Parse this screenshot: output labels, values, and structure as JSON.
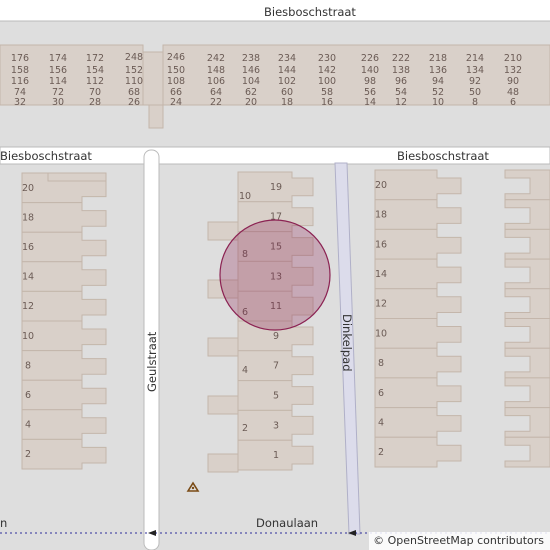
{
  "roads": {
    "top": "Biesboschstraat",
    "left_segment": "Biesboschstraat",
    "right_segment": "Biesboschstraat",
    "vertical_left": "Geulstraat",
    "vertical_right": "Dinkelpad",
    "bottom": "Donaulaan",
    "bottom_left_fragment": "n"
  },
  "top_block_numbers": [
    [
      "176",
      "158",
      "116",
      "74",
      "32"
    ],
    [
      "174",
      "156",
      "114",
      "72",
      "30"
    ],
    [
      "172",
      "154",
      "112",
      "70",
      "28"
    ],
    [
      "248",
      "152",
      "110",
      "68",
      "26"
    ],
    [
      "246",
      "150",
      "108",
      "66",
      "24"
    ],
    [
      "242",
      "148",
      "106",
      "64",
      "22"
    ],
    [
      "238",
      "146",
      "104",
      "62",
      "20"
    ],
    [
      "234",
      "144",
      "102",
      "60",
      "18"
    ],
    [
      "230",
      "142",
      "100",
      "58",
      "16"
    ],
    [
      "226",
      "140",
      "98",
      "56",
      "14"
    ],
    [
      "222",
      "138",
      "96",
      "54",
      "12"
    ],
    [
      "218",
      "136",
      "94",
      "52",
      "10"
    ],
    [
      "214",
      "134",
      "92",
      "50",
      "8"
    ],
    [
      "210",
      "132",
      "90",
      "48",
      "6"
    ]
  ],
  "left_block_numbers": [
    "20",
    "18",
    "16",
    "14",
    "12",
    "10",
    "8",
    "6",
    "4",
    "2"
  ],
  "middle_block_odd": [
    "19",
    "17",
    "15",
    "13",
    "11",
    "9",
    "7",
    "5",
    "3",
    "1"
  ],
  "middle_block_even": [
    "10",
    "8",
    "6",
    "4",
    "2"
  ],
  "right_block_numbers": [
    "20",
    "18",
    "16",
    "14",
    "12",
    "10",
    "8",
    "6",
    "4",
    "2"
  ],
  "marker": {
    "color": "#8b2252"
  },
  "recycling_icon": "recycling-icon",
  "attribution": {
    "symbol": "©",
    "text": "OpenStreetMap contributors"
  },
  "colors": {
    "background": "#dedede",
    "building": "#d9d0c9",
    "building_stroke": "#c4b6ab",
    "road": "#ffffff",
    "road_casing": "#bbbbbb",
    "path": "#dcdceb"
  }
}
